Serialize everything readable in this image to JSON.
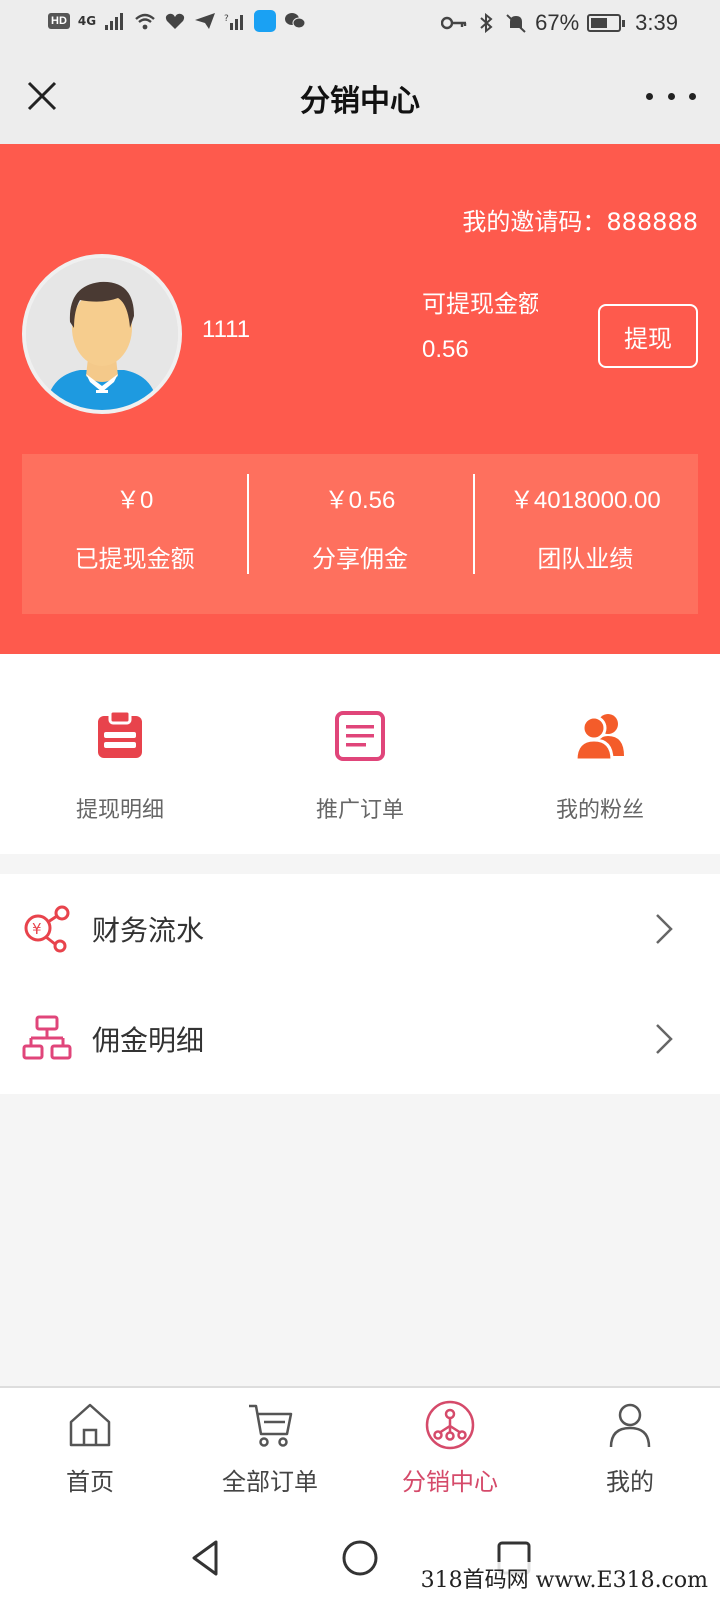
{
  "status_bar": {
    "network": "4G",
    "battery_percent": "67%",
    "time": "3:39",
    "battery_level": 0.67
  },
  "title_bar": {
    "title": "分销中心"
  },
  "header": {
    "invite_label": "我的邀请码：888888",
    "username": "1111",
    "withdrawable_label": "可提现金额",
    "withdrawable_value": "0.56",
    "withdraw_button": "提现",
    "stats": [
      {
        "value": "￥0",
        "label": "已提现金额"
      },
      {
        "value": "￥0.56",
        "label": "分享佣金"
      },
      {
        "value": "￥4018000.00",
        "label": "团队业绩"
      }
    ]
  },
  "quick_menu": [
    {
      "label": "提现明细",
      "icon": "clipboard-icon",
      "color": "#e8434c"
    },
    {
      "label": "推广订单",
      "icon": "document-icon",
      "color": "#e0457a"
    },
    {
      "label": "我的粉丝",
      "icon": "users-icon",
      "color": "#f45c2a"
    }
  ],
  "list": [
    {
      "label": "财务流水",
      "icon": "finance-flow-icon",
      "color": "#e8434c"
    },
    {
      "label": "佣金明细",
      "icon": "hierarchy-icon",
      "color": "#e0457a"
    }
  ],
  "tabbar": [
    {
      "label": "首页",
      "icon": "home-icon"
    },
    {
      "label": "全部订单",
      "icon": "cart-icon"
    },
    {
      "label": "分销中心",
      "icon": "distribution-icon",
      "active": true
    },
    {
      "label": "我的",
      "icon": "user-icon"
    }
  ],
  "watermark": "318首码网 www.E318.com",
  "colors": {
    "header_bg": "#fe5a4d",
    "stats_bg": "#fe705e",
    "accent": "#d54a6a"
  }
}
